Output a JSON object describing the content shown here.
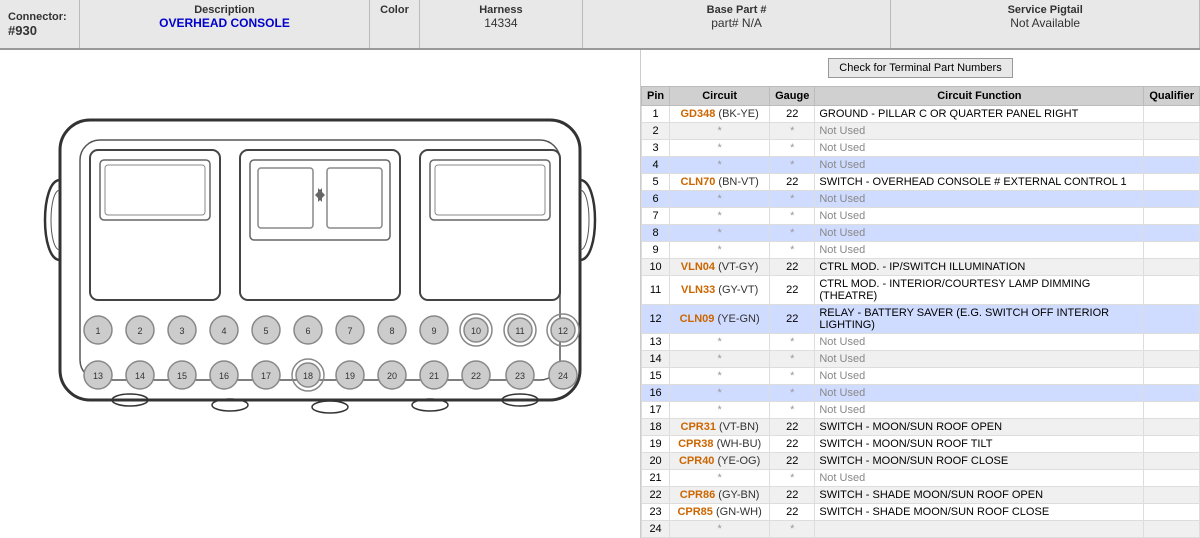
{
  "header": {
    "connector_label": "Connector:",
    "connector_value": "#930",
    "description_label": "Description",
    "description_value": "OVERHEAD CONSOLE",
    "color_label": "Color",
    "harness_label": "Harness",
    "harness_value": "14334",
    "base_part_label": "Base Part #",
    "base_part_value": "part# N/A",
    "service_pigtail_label": "Service Pigtail",
    "service_pigtail_value": "Not Available"
  },
  "check_button": "Check for Terminal Part Numbers",
  "table_headers": [
    "Pin",
    "Circuit",
    "Gauge",
    "Circuit Function",
    "Qualifier"
  ],
  "pins": [
    {
      "pin": "1",
      "circuit": "GD348 (BK-YE)",
      "gauge": "22",
      "fn": "GROUND - PILLAR C OR QUARTER PANEL RIGHT",
      "qualifier": "",
      "used": true,
      "highlight": false
    },
    {
      "pin": "2",
      "circuit": "*",
      "gauge": "*",
      "fn": "Not Used",
      "qualifier": "",
      "used": false,
      "highlight": false
    },
    {
      "pin": "3",
      "circuit": "*",
      "gauge": "*",
      "fn": "Not Used",
      "qualifier": "",
      "used": false,
      "highlight": false
    },
    {
      "pin": "4",
      "circuit": "*",
      "gauge": "*",
      "fn": "Not Used",
      "qualifier": "",
      "used": false,
      "highlight": true
    },
    {
      "pin": "5",
      "circuit": "CLN70 (BN-VT)",
      "gauge": "22",
      "fn": "SWITCH - OVERHEAD CONSOLE # EXTERNAL CONTROL 1",
      "qualifier": "",
      "used": true,
      "highlight": false
    },
    {
      "pin": "6",
      "circuit": "*",
      "gauge": "*",
      "fn": "Not Used",
      "qualifier": "",
      "used": false,
      "highlight": true
    },
    {
      "pin": "7",
      "circuit": "*",
      "gauge": "*",
      "fn": "Not Used",
      "qualifier": "",
      "used": false,
      "highlight": false
    },
    {
      "pin": "8",
      "circuit": "*",
      "gauge": "*",
      "fn": "Not Used",
      "qualifier": "",
      "used": false,
      "highlight": true
    },
    {
      "pin": "9",
      "circuit": "*",
      "gauge": "*",
      "fn": "Not Used",
      "qualifier": "",
      "used": false,
      "highlight": false
    },
    {
      "pin": "10",
      "circuit": "VLN04 (VT-GY)",
      "gauge": "22",
      "fn": "CTRL MOD. - IP/SWITCH ILLUMINATION",
      "qualifier": "",
      "used": true,
      "highlight": false
    },
    {
      "pin": "11",
      "circuit": "VLN33 (GY-VT)",
      "gauge": "22",
      "fn": "CTRL MOD. - INTERIOR/COURTESY LAMP DIMMING (THEATRE)",
      "qualifier": "",
      "used": true,
      "highlight": false
    },
    {
      "pin": "12",
      "circuit": "CLN09 (YE-GN)",
      "gauge": "22",
      "fn": "RELAY - BATTERY SAVER (E.G. SWITCH OFF INTERIOR LIGHTING)",
      "qualifier": "",
      "used": true,
      "highlight": true
    },
    {
      "pin": "13",
      "circuit": "*",
      "gauge": "*",
      "fn": "Not Used",
      "qualifier": "",
      "used": false,
      "highlight": false
    },
    {
      "pin": "14",
      "circuit": "*",
      "gauge": "*",
      "fn": "Not Used",
      "qualifier": "",
      "used": false,
      "highlight": false
    },
    {
      "pin": "15",
      "circuit": "*",
      "gauge": "*",
      "fn": "Not Used",
      "qualifier": "",
      "used": false,
      "highlight": false
    },
    {
      "pin": "16",
      "circuit": "*",
      "gauge": "*",
      "fn": "Not Used",
      "qualifier": "",
      "used": false,
      "highlight": true
    },
    {
      "pin": "17",
      "circuit": "*",
      "gauge": "*",
      "fn": "Not Used",
      "qualifier": "",
      "used": false,
      "highlight": false
    },
    {
      "pin": "18",
      "circuit": "CPR31 (VT-BN)",
      "gauge": "22",
      "fn": "SWITCH - MOON/SUN ROOF OPEN",
      "qualifier": "",
      "used": true,
      "highlight": false
    },
    {
      "pin": "19",
      "circuit": "CPR38 (WH-BU)",
      "gauge": "22",
      "fn": "SWITCH - MOON/SUN ROOF TILT",
      "qualifier": "",
      "used": true,
      "highlight": false
    },
    {
      "pin": "20",
      "circuit": "CPR40 (YE-OG)",
      "gauge": "22",
      "fn": "SWITCH - MOON/SUN ROOF CLOSE",
      "qualifier": "",
      "used": true,
      "highlight": false
    },
    {
      "pin": "21",
      "circuit": "*",
      "gauge": "*",
      "fn": "Not Used",
      "qualifier": "",
      "used": false,
      "highlight": false
    },
    {
      "pin": "22",
      "circuit": "CPR86 (GY-BN)",
      "gauge": "22",
      "fn": "SWITCH - SHADE MOON/SUN ROOF OPEN",
      "qualifier": "",
      "used": true,
      "highlight": false
    },
    {
      "pin": "23",
      "circuit": "CPR85 (GN-WH)",
      "gauge": "22",
      "fn": "SWITCH - SHADE MOON/SUN ROOF CLOSE",
      "qualifier": "",
      "used": true,
      "highlight": false
    },
    {
      "pin": "24",
      "circuit": "*",
      "gauge": "*",
      "fn": "",
      "qualifier": "",
      "used": false,
      "highlight": false
    }
  ]
}
